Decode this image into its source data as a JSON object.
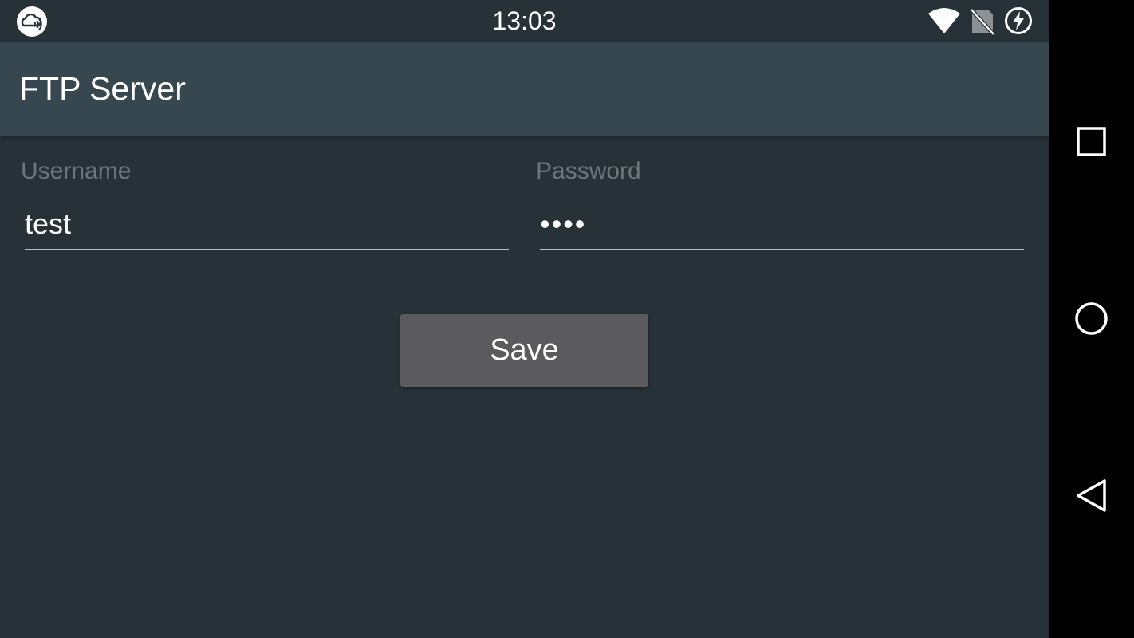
{
  "status_bar": {
    "time": "13:03",
    "icons": [
      "cloud-sync-icon",
      "wifi-icon",
      "no-sim-icon",
      "battery-charging-icon"
    ]
  },
  "app_bar": {
    "title": "FTP Server"
  },
  "form": {
    "username": {
      "label": "Username",
      "value": "test"
    },
    "password": {
      "label": "Password",
      "value": "••••"
    },
    "save_label": "Save"
  },
  "nav_bar": {
    "buttons": [
      "recents-icon",
      "home-icon",
      "back-icon"
    ]
  },
  "colors": {
    "background": "#263238",
    "app_bar": "#37474f",
    "button": "#5b5b5d",
    "label": "#6b767b",
    "nav_bar": "#000000"
  }
}
